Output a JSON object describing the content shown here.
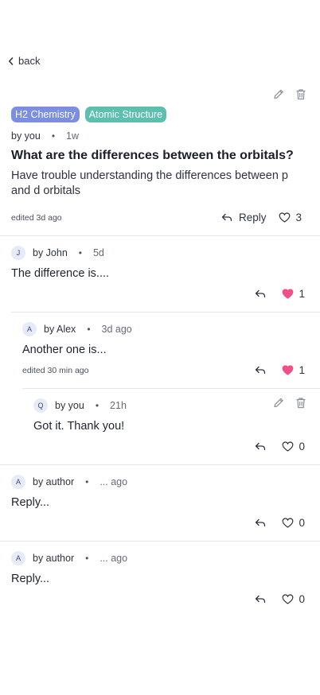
{
  "back_label": "back",
  "colors": {
    "tag1": "#7c8ee0",
    "tag2": "#5dbfb0",
    "heart_filled": "#f0508a",
    "text": "#1f2330"
  },
  "post": {
    "tags": [
      "H2 Chemistry",
      "Atomic Structure"
    ],
    "author": "by you",
    "time": "1w",
    "title": "What are the differences between the orbitals?",
    "body": "Have trouble understanding the differences between  p and d orbitals",
    "edited": "edited 3d ago",
    "reply_label": "Reply",
    "likes": "3"
  },
  "comments": [
    {
      "initial": "J",
      "author": "by John",
      "time": "5d",
      "text": "The difference is....",
      "likes": "1",
      "liked": true
    },
    {
      "initial": "A",
      "author": "by Alex",
      "time": "3d ago",
      "text": "Another one is...",
      "edited": "edited 30 min ago",
      "likes": "1",
      "liked": true
    },
    {
      "initial": "Q",
      "author": "by you",
      "time": "21h",
      "text": "Got it. Thank you!",
      "likes": "0",
      "liked": false
    },
    {
      "initial": "A",
      "author": "by author",
      "time": "... ago",
      "text": "Reply...",
      "likes": "0",
      "liked": false
    },
    {
      "initial": "A",
      "author": "by author",
      "time": "... ago",
      "text": "Reply...",
      "likes": "0",
      "liked": false
    }
  ],
  "icons": [
    "chevron-left-icon",
    "pencil-icon",
    "trash-icon",
    "reply-arrow-icon",
    "heart-outline-icon",
    "heart-filled-icon"
  ]
}
